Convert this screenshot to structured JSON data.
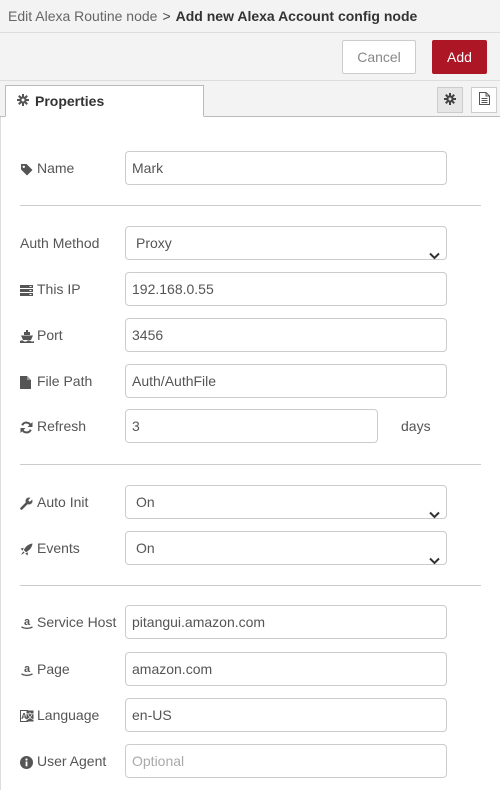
{
  "title": {
    "crumb": "Edit Alexa Routine node",
    "separator": ">",
    "current": "Add new Alexa Account config node"
  },
  "actions": {
    "cancel": "Cancel",
    "add": "Add"
  },
  "tabs": {
    "properties": "Properties"
  },
  "form": {
    "name": {
      "label": "Name",
      "value": "Mark"
    },
    "auth_method": {
      "label": "Auth Method",
      "value": "Proxy"
    },
    "this_ip": {
      "label": "This IP",
      "value": "192.168.0.55"
    },
    "port": {
      "label": "Port",
      "value": "3456"
    },
    "file_path": {
      "label": "File Path",
      "value": "Auth/AuthFile"
    },
    "refresh": {
      "label": "Refresh",
      "value": "3",
      "suffix": "days"
    },
    "auto_init": {
      "label": "Auto Init",
      "value": "On"
    },
    "events": {
      "label": "Events",
      "value": "On"
    },
    "service_host": {
      "label": "Service Host",
      "value": "pitangui.amazon.com"
    },
    "page": {
      "label": "Page",
      "value": "amazon.com"
    },
    "language": {
      "label": "Language",
      "value": "en-US"
    },
    "user_agent": {
      "label": "User Agent",
      "value": "",
      "placeholder": "Optional"
    }
  },
  "icons": {
    "name": "tag-icon",
    "this_ip": "server-icon",
    "port": "ship-icon",
    "file_path": "file-icon",
    "refresh": "refresh-icon",
    "auto_init": "wrench-icon",
    "events": "rocket-icon",
    "service_host": "amazon-icon",
    "page": "amazon-icon",
    "language": "language-icon",
    "user_agent": "info-circle-icon"
  },
  "colors": {
    "accent": "#ad1625",
    "toolbar_bg": "#f3f3f3"
  }
}
